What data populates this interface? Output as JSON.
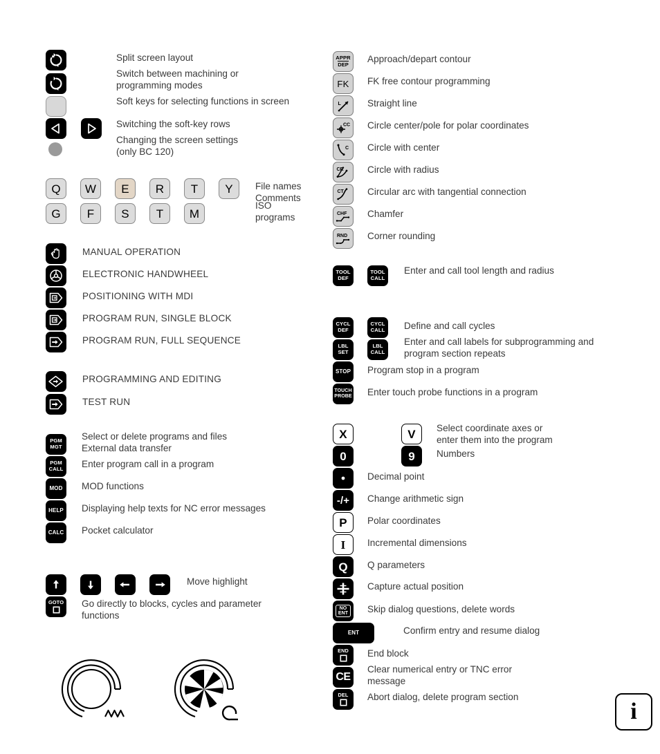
{
  "document": {
    "title": "TNC control panel key legend",
    "info_badge": "i"
  },
  "colors": {
    "key_black": "#000000",
    "key_grey": "#dcdcdc",
    "key_tan": "#e3d6c6",
    "text": "#3a3a3a",
    "softkey_grey": "#d8d8d8",
    "dot_grey": "#9a9a9a"
  },
  "left_column": {
    "screen_section": {
      "descriptions": [
        "Split screen layout",
        "Switch between machining or\nprogramming modes",
        "Soft keys for selecting functions in screen",
        "Switching the soft-key rows",
        "Changing the screen settings\n(only BC 120)"
      ],
      "keys": [
        {
          "name": "split-screen-key",
          "icon": "circular-arrows-icon",
          "style": "black"
        },
        {
          "name": "mode-switch-key",
          "icon": "circular-arrows-icon",
          "style": "black"
        },
        {
          "name": "soft-key",
          "icon": "blank-softkey-icon",
          "style": "softkey"
        },
        {
          "name": "softkey-row-left-key",
          "icon": "triangle-left-icon",
          "style": "black"
        },
        {
          "name": "softkey-row-right-key",
          "icon": "triangle-right-icon",
          "style": "black"
        },
        {
          "name": "screen-settings-knob",
          "icon": "round-knob-icon",
          "style": "dot"
        }
      ]
    },
    "alpha_section": {
      "row1": [
        "Q",
        "W",
        "E",
        "R",
        "T",
        "Y"
      ],
      "row2": [
        "G",
        "F",
        "S",
        "T",
        "M"
      ],
      "desc1": "File names\nComments",
      "desc2": "ISO\nprograms"
    },
    "modes_section": {
      "items": [
        {
          "key_name": "manual-operation-key",
          "icon": "hand-icon",
          "label": "MANUAL OPERATION"
        },
        {
          "key_name": "electronic-handwheel-key",
          "icon": "handwheel-icon",
          "label": "ELECTRONIC HANDWHEEL"
        },
        {
          "key_name": "positioning-mdi-key",
          "icon": "mdi-arrow-icon",
          "label": "POSITIONING WITH MDI"
        },
        {
          "key_name": "program-run-single-block-key",
          "icon": "single-block-arrow-icon",
          "label": "PROGRAM RUN, SINGLE BLOCK"
        },
        {
          "key_name": "program-run-full-sequence-key",
          "icon": "full-sequence-arrow-icon",
          "label": "PROGRAM RUN, FULL SEQUENCE"
        }
      ]
    },
    "programming_section": {
      "items": [
        {
          "key_name": "programming-editing-key",
          "icon": "diamond-arrow-icon",
          "label": "PROGRAMMING AND EDITING"
        },
        {
          "key_name": "test-run-key",
          "icon": "test-run-arrow-icon",
          "label": "TEST RUN"
        }
      ]
    },
    "pgm_section": {
      "items": [
        {
          "key_name": "pgm-mgt-key",
          "top": "PGM",
          "bottom": "MGT",
          "label": "Select or delete programs and files\nExternal data transfer"
        },
        {
          "key_name": "pgm-call-key",
          "top": "PGM",
          "bottom": "CALL",
          "label": "Enter program call in a program"
        },
        {
          "key_name": "mod-key",
          "top": "MOD",
          "bottom": "",
          "label": "MOD functions"
        },
        {
          "key_name": "help-key",
          "top": "HELP",
          "bottom": "",
          "label": "Displaying help texts for NC error messages"
        },
        {
          "key_name": "calc-key",
          "top": "CALC",
          "bottom": "",
          "label": "Pocket calculator"
        }
      ]
    },
    "navigation_section": {
      "arrow_keys": [
        "arrow-up-key",
        "arrow-down-key",
        "arrow-left-key",
        "arrow-right-key"
      ],
      "arrow_label": "Move highlight",
      "goto_label_top": "GOTO",
      "goto_desc": "Go directly to blocks, cycles and parameter\nfunctions"
    },
    "potentiometers": [
      {
        "name": "feed-rate-override-potentiometer",
        "icon": "feed-rate-dial-icon"
      },
      {
        "name": "spindle-speed-override-potentiometer",
        "icon": "spindle-speed-dial-icon"
      }
    ]
  },
  "right_column": {
    "path_section": [
      {
        "key_name": "appr-dep-key",
        "top": "APPR",
        "bottom": "DEP",
        "label": "Approach/depart contour"
      },
      {
        "key_name": "fk-key",
        "text": "FK",
        "label": "FK free contour programming"
      },
      {
        "key_name": "straight-line-key",
        "icon": "straight-line-icon",
        "label": "Straight line"
      },
      {
        "key_name": "circle-center-pole-key",
        "icon": "circle-center-icon",
        "label": "Circle center/pole for polar coordinates"
      },
      {
        "key_name": "circle-with-center-key",
        "icon": "arc-c-icon",
        "label": "Circle with center"
      },
      {
        "key_name": "circle-with-radius-key",
        "icon": "arc-cr-icon",
        "label": "Circle with radius"
      },
      {
        "key_name": "circular-arc-tangential-key",
        "icon": "arc-ct-icon",
        "label": "Circular arc with tangential connection"
      },
      {
        "key_name": "chamfer-key",
        "icon": "chamfer-icon",
        "label": "Chamfer"
      },
      {
        "key_name": "corner-rounding-key",
        "icon": "rounding-icon",
        "label": "Corner rounding"
      }
    ],
    "tool_section": {
      "keys": [
        {
          "key_name": "tool-def-key",
          "top": "TOOL",
          "bottom": "DEF"
        },
        {
          "key_name": "tool-call-key",
          "top": "TOOL",
          "bottom": "CALL"
        }
      ],
      "label": "Enter and call tool length and radius"
    },
    "cycle_section": [
      {
        "keys": [
          {
            "key_name": "cycl-def-key",
            "top": "CYCL",
            "bottom": "DEF"
          },
          {
            "key_name": "cycl-call-key",
            "top": "CYCL",
            "bottom": "CALL"
          }
        ],
        "label": "Define and call cycles"
      },
      {
        "keys": [
          {
            "key_name": "lbl-set-key",
            "top": "LBL",
            "bottom": "SET"
          },
          {
            "key_name": "lbl-call-key",
            "top": "LBL",
            "bottom": "CALL"
          }
        ],
        "label": "Enter and call labels for subprogramming and\nprogram section repeats"
      },
      {
        "keys": [
          {
            "key_name": "stop-key",
            "top": "STOP",
            "bottom": ""
          }
        ],
        "label": "Program stop in a program"
      },
      {
        "keys": [
          {
            "key_name": "touch-probe-key",
            "top": "TOUCH",
            "bottom": "PROBE"
          }
        ],
        "label": "Enter touch probe functions in a program"
      }
    ],
    "entry_section": {
      "axis_keys": [
        {
          "key_name": "axis-x-key",
          "text": "X",
          "style": "white"
        },
        {
          "key_name": "axis-v-key",
          "text": "V",
          "style": "white"
        }
      ],
      "axis_label": "Select coordinate axes or\nenter them into the program",
      "number_keys": [
        {
          "key_name": "number-0-key",
          "text": "0",
          "style": "black"
        },
        {
          "key_name": "number-9-key",
          "text": "9",
          "style": "black"
        }
      ],
      "number_label": "Numbers",
      "items": [
        {
          "key_name": "decimal-point-key",
          "icon": "dot-icon",
          "style": "black",
          "label": "Decimal point"
        },
        {
          "key_name": "sign-change-key",
          "text": "-/+",
          "style": "black",
          "label": "Change arithmetic sign"
        },
        {
          "key_name": "polar-coordinates-key",
          "text": "P",
          "style": "white",
          "label": "Polar coordinates"
        },
        {
          "key_name": "incremental-key",
          "text": "I",
          "style": "white",
          "label": "Incremental dimensions"
        },
        {
          "key_name": "q-parameter-key",
          "text": "Q",
          "style": "black",
          "label": "Q parameters"
        },
        {
          "key_name": "capture-position-key",
          "icon": "crosshair-icon",
          "style": "black",
          "label": "Capture actual position"
        },
        {
          "key_name": "no-ent-key",
          "top": "NO",
          "bottom": "ENT",
          "style": "black-boxed",
          "label": "Skip dialog questions, delete words"
        },
        {
          "key_name": "ent-key",
          "text": "ENT",
          "style": "black-wide",
          "label": "Confirm entry and resume dialog"
        },
        {
          "key_name": "end-key",
          "top": "END",
          "icon": "square-icon",
          "style": "black",
          "label": "End block"
        },
        {
          "key_name": "ce-key",
          "text": "CE",
          "style": "black",
          "label": "Clear numerical entry or TNC error\nmessage"
        },
        {
          "key_name": "del-key",
          "top": "DEL",
          "icon": "square-icon",
          "style": "black",
          "label": "Abort dialog, delete program section"
        }
      ]
    }
  }
}
